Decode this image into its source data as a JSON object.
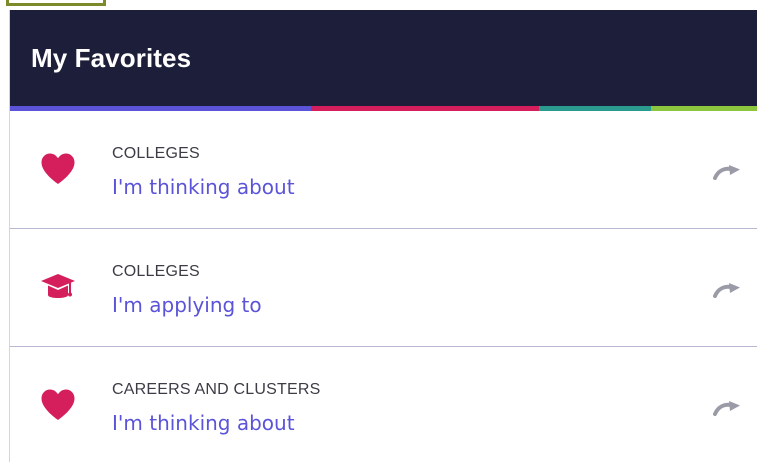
{
  "panel": {
    "title": "My Favorites",
    "stripe_colors": [
      "#5b54d8",
      "#d41f5c",
      "#2b9a8f",
      "#8cc63f"
    ]
  },
  "favorites": [
    {
      "category": "COLLEGES",
      "label": "I'm thinking about",
      "icon": "heart-icon"
    },
    {
      "category": "COLLEGES",
      "label": "I'm applying to",
      "icon": "graduation-cap-icon"
    },
    {
      "category": "CAREERS AND CLUSTERS",
      "label": "I'm thinking about",
      "icon": "heart-icon"
    }
  ],
  "colors": {
    "header_bg": "#1c1e3a",
    "icon_pink": "#d41f5c",
    "link_purple": "#5b54d8",
    "share_gray": "#9b9ba8"
  }
}
